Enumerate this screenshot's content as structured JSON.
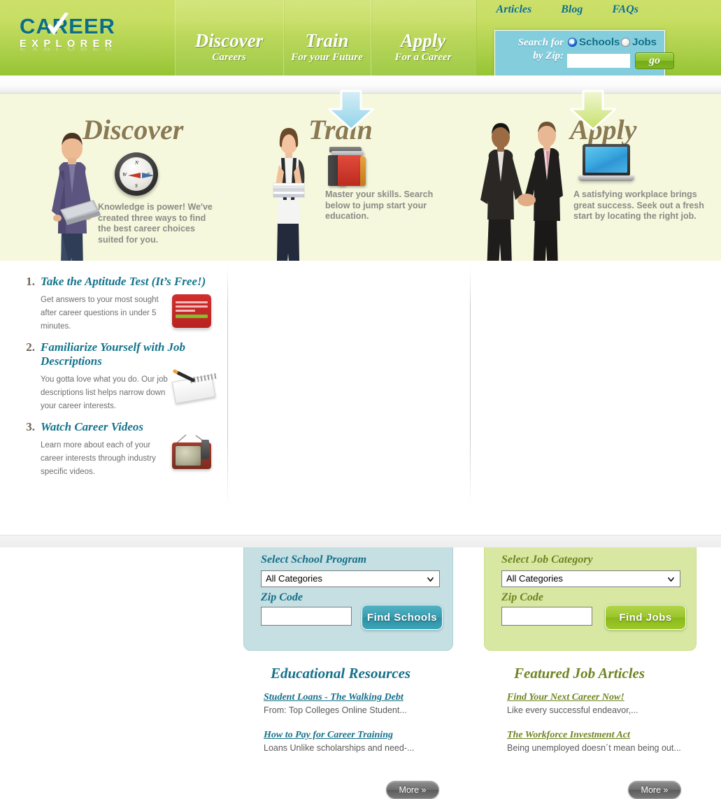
{
  "brand": {
    "name_top": "CAREER",
    "name_bottom": "EXPLORER",
    "check_icon": "check-icon",
    "logo_color": "#0b6d86"
  },
  "header": {
    "nav": [
      {
        "title": "Discover",
        "subtitle": "Careers"
      },
      {
        "title": "Train",
        "subtitle": "For your Future"
      },
      {
        "title": "Apply",
        "subtitle": "For a Career"
      }
    ],
    "top_links": [
      {
        "label": "Articles"
      },
      {
        "label": "Blog"
      },
      {
        "label": "FAQs"
      }
    ],
    "search": {
      "label_line1": "Search for",
      "label_line2": "by Zip:",
      "option_schools": "Schools",
      "option_jobs": "Jobs",
      "selected": "Schools",
      "zip_value": "",
      "zip_placeholder": "",
      "go_label": "go",
      "accent": "#83cddd"
    }
  },
  "hero": {
    "background": "#f5f8dc",
    "columns": [
      {
        "title": "Discover",
        "icon": "compass-icon",
        "photo": "man-with-laptop-photo",
        "description": "Knowledge is power! We've created three ways to find the best career choices suited for you."
      },
      {
        "title": "Train",
        "icon": "stack-of-books-icon",
        "photo": "student-with-books-photo",
        "description": "Master your skills. Search below to jump start your education."
      },
      {
        "title": "Apply",
        "icon": "laptop-icon",
        "photo": "businessmen-handshake-photo",
        "description": "A satisfying workplace brings great success. Seek out a fresh start by locating the right job."
      }
    ],
    "compass_letters": [
      "N",
      "E",
      "S",
      "W"
    ]
  },
  "steps": [
    {
      "number": "1.",
      "title": "Take the Aptitude Test (It’s Free!)",
      "body": "Get answers to your most sought after career questions in under 5 minutes.",
      "icon": "aptitude-test-form-icon"
    },
    {
      "number": "2.",
      "title": "Familiarize Yourself with Job Descriptions",
      "body": "You gotta love what you do. Our job descriptions list helps narrow down your career interests.",
      "icon": "notepad-and-pen-icon"
    },
    {
      "number": "3.",
      "title": "Watch Career Videos",
      "body": "Learn more about each of your career interests through industry specific videos.",
      "icon": "television-icon"
    }
  ],
  "schools_panel": {
    "arrow": "down-arrow-blue-icon",
    "program_label": "Select School Program",
    "program_value": "All Categories",
    "program_options": [
      "All Categories"
    ],
    "zip_label": "Zip Code",
    "zip_value": "",
    "zip_placeholder": "",
    "find_label": "Find Schools",
    "accent": "#15708a",
    "background": "#c5dfe2"
  },
  "jobs_panel": {
    "arrow": "down-arrow-green-icon",
    "category_label": "Select Job Category",
    "category_value": "All Categories",
    "category_options": [
      "All Categories"
    ],
    "zip_label": "Zip Code",
    "zip_value": "",
    "zip_placeholder": "",
    "find_label": "Find Jobs",
    "accent": "#6f8420",
    "background": "#d8e8a3"
  },
  "educational_resources": {
    "heading": "Educational Resources",
    "items": [
      {
        "title": "Student Loans - The Walking Debt",
        "snippet": "From: Top Colleges Online Student..."
      },
      {
        "title": "How to Pay for Career Training",
        "snippet": "Loans Unlike scholarships and need-..."
      }
    ],
    "more_label": "More »"
  },
  "featured_job_articles": {
    "heading": "Featured Job Articles",
    "items": [
      {
        "title": "Find Your Next Career Now!",
        "snippet": "Like every successful endeavor,..."
      },
      {
        "title": "The Workforce Investment Act",
        "snippet": "Being unemployed doesn´t mean being out..."
      }
    ],
    "more_label": "More »"
  }
}
